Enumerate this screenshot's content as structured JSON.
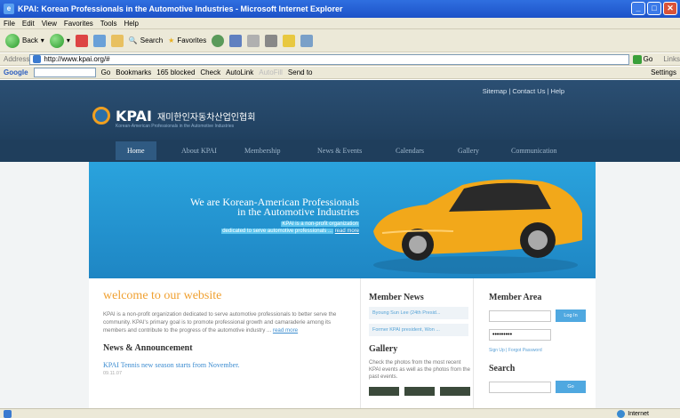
{
  "window": {
    "title": "KPAI: Korean Professionals in the Automotive Industries - Microsoft Internet Explorer"
  },
  "menu": [
    "File",
    "Edit",
    "View",
    "Favorites",
    "Tools",
    "Help"
  ],
  "toolbar": {
    "back": "Back",
    "search": "Search",
    "favorites": "Favorites"
  },
  "address": {
    "label": "Address",
    "url": "http://www.kpai.org/#",
    "go": "Go",
    "links": "Links"
  },
  "googlebar": {
    "label": "Google",
    "go": "Go",
    "bookmarks": "Bookmarks",
    "blocked": "165 blocked",
    "check": "Check",
    "autolink": "AutoLink",
    "autofill": "AutoFill",
    "sendto": "Send to",
    "settings": "Settings"
  },
  "site": {
    "toplinks": "Sitemap | Contact Us | Help",
    "logo": {
      "name": "KPAI",
      "korean": "재미한인자동차산업인협회",
      "sub": "Korean-American Professionals in the Automotive Industries"
    },
    "nav": [
      "Home",
      "About KPAI",
      "Membership",
      "News & Events",
      "Calendars",
      "Gallery",
      "Communication"
    ],
    "hero": {
      "line1": "We are Korean-American Professionals",
      "line2": "in the Automotive Industries",
      "sub1": "KPAI is a non-profit organization",
      "sub2": "dedicated to serve automotive professionals ...",
      "more": "read more"
    },
    "welcome": {
      "title": "welcome to our website",
      "body": "KPAI is a non-profit organization dedicated to serve automotive professionals to better serve the community. KPAI's primary goal is to promote professional growth and camaraderie among its members and contribute to the progress of the automotive industry ...",
      "more": "read more"
    },
    "news_title": "News & Announcement",
    "news_item": "KPAI Tennis new season starts from November.",
    "news_date": "09.11.07",
    "member_news": {
      "title": "Member News",
      "items": [
        "Byoung Sun Lee (24th Presid...",
        "Former KPAI president, Won ..."
      ]
    },
    "gallery": {
      "title": "Gallery",
      "text": "Check the photos from the most recent KPAI events as well as the photos from the past events."
    },
    "member_area": {
      "title": "Member Area",
      "password": "•••••••••",
      "login": "Log In",
      "links": "Sign Up | Forgot Password"
    },
    "search": {
      "title": "Search",
      "go": "Go"
    }
  },
  "status": {
    "zone": "Internet"
  }
}
